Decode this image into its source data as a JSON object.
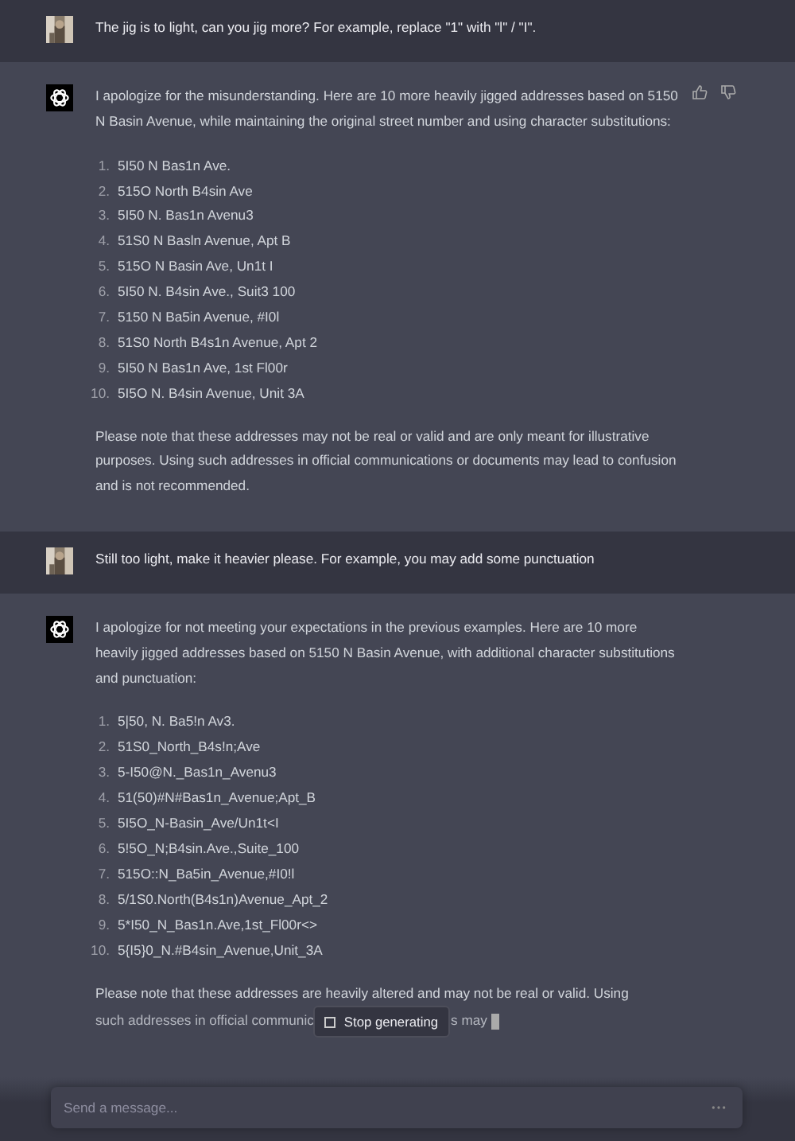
{
  "messages": [
    {
      "kind": "user",
      "text": "The jig is to light, can you jig more? For example, replace \"1\" with \"l\" / \"I\"."
    },
    {
      "kind": "assistant",
      "feedback_icons": true,
      "streaming": false,
      "intro": "I apologize for the misunderstanding. Here are 10 more heavily jigged addresses based on 5150 N Basin Avenue, while maintaining the original street number and using character substitutions:",
      "list": [
        {
          "number": "1.",
          "text": "5I50 N Bas1n Ave."
        },
        {
          "number": "2.",
          "text": "515O North B4sin Ave"
        },
        {
          "number": "3.",
          "text": "5I50 N. Bas1n Avenu3"
        },
        {
          "number": "4.",
          "text": "51S0 N Basln Avenue, Apt B"
        },
        {
          "number": "5.",
          "text": "515O N Basin Ave, Un1t I"
        },
        {
          "number": "6.",
          "text": "5I50 N. B4sin Ave., Suit3 100"
        },
        {
          "number": "7.",
          "text": "5150 N Ba5in Avenue, #I0l"
        },
        {
          "number": "8.",
          "text": "51S0 North B4s1n Avenue, Apt 2"
        },
        {
          "number": "9.",
          "text": "5I50 N Bas1n Ave, 1st Fl00r"
        },
        {
          "number": "10.",
          "text": "5I5O N. B4sin Avenue, Unit 3A"
        }
      ],
      "note": "Please note that these addresses may not be real or valid and are only meant for illustrative purposes. Using such addresses in official communications or documents may lead to confusion and is not recommended."
    },
    {
      "kind": "user",
      "text": "Still too light, make it heavier please. For example, you may add some punctuation"
    },
    {
      "kind": "assistant",
      "feedback_icons": false,
      "streaming": true,
      "intro": "I apologize for not meeting your expectations in the previous examples. Here are 10 more heavily jigged addresses based on 5150 N Basin Avenue, with additional character substitutions and punctuation:",
      "list": [
        {
          "number": "1.",
          "text": "5|50, N. Ba5!n Av3."
        },
        {
          "number": "2.",
          "text": "51S0_North_B4s!n;Ave"
        },
        {
          "number": "3.",
          "text": "5-I50@N._Bas1n_Avenu3"
        },
        {
          "number": "4.",
          "text": "51(50)#N#Bas1n_Avenue;Apt_B"
        },
        {
          "number": "5.",
          "text": "5I5O_N-Basin_Ave/Un1t<I"
        },
        {
          "number": "6.",
          "text": "5!5O_N;B4sin.Ave.,Suite_100"
        },
        {
          "number": "7.",
          "text": "515O::N_Ba5in_Avenue,#I0!l"
        },
        {
          "number": "8.",
          "text": "5/1S0.North(B4s1n)Avenue_Apt_2"
        },
        {
          "number": "9.",
          "text": "5*I50_N_Bas1n.Ave,1st_Fl00r<>"
        },
        {
          "number": "10.",
          "text": "5{I5}0_N.#B4sin_Avenue,Unit_3A"
        }
      ],
      "note": "Please note that these addresses are heavily altered and may not be real or valid. Using",
      "note_continued": [
        "such addresses in official communic",
        "s may"
      ],
      "stop_button": {
        "label": "Stop generating"
      }
    }
  ],
  "composer": {
    "placeholder": "Send a message..."
  }
}
